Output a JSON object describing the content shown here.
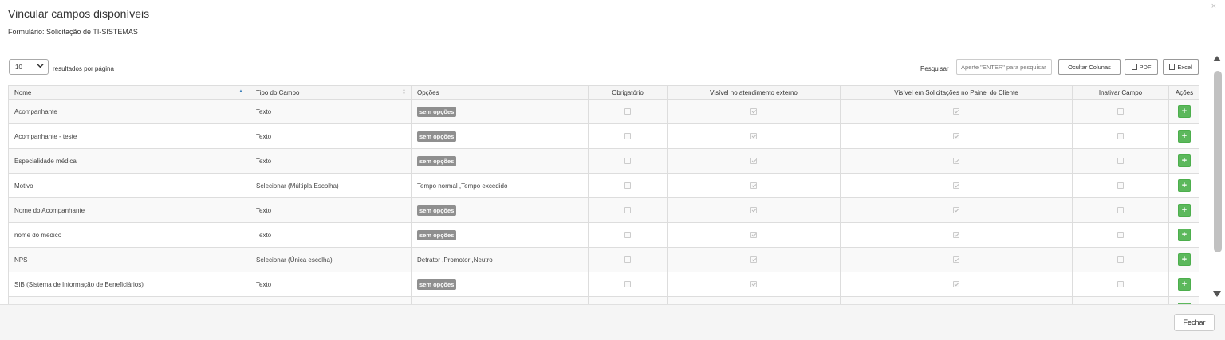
{
  "modal": {
    "title": "Vincular campos disponíveis",
    "subtitle": "Formulário: Solicitação de TI-SISTEMAS",
    "close_glyph": "×"
  },
  "controls": {
    "page_length": "10",
    "page_length_label": "resultados por página",
    "search_label": "Pesquisar",
    "search_placeholder": "Aperte \"ENTER\" para pesquisar",
    "hide_columns_label": "Ocultar Colunas",
    "pdf_label": "PDF",
    "excel_label": "Excel"
  },
  "table": {
    "columns": [
      "Nome",
      "Tipo do Campo",
      "Opções",
      "Obrigatório",
      "Visível no atendimento externo",
      "Visível em Solicitações no Painel do Cliente",
      "Inativar Campo",
      "Ações"
    ],
    "no_options_label": "sem opções",
    "add_label": "+",
    "rows": [
      {
        "nome": "Acompanhante",
        "tipo": "Texto",
        "opcoes": "",
        "obrigatorio": false,
        "visivel_externo": true,
        "visivel_painel": true,
        "inativar": false
      },
      {
        "nome": "Acompanhante - teste",
        "tipo": "Texto",
        "opcoes": "",
        "obrigatorio": false,
        "visivel_externo": true,
        "visivel_painel": true,
        "inativar": false
      },
      {
        "nome": "Especialidade médica",
        "tipo": "Texto",
        "opcoes": "",
        "obrigatorio": false,
        "visivel_externo": true,
        "visivel_painel": true,
        "inativar": false
      },
      {
        "nome": "Motivo",
        "tipo": "Selecionar (Múltipla Escolha)",
        "opcoes": "Tempo normal ,Tempo excedido",
        "obrigatorio": false,
        "visivel_externo": true,
        "visivel_painel": true,
        "inativar": false
      },
      {
        "nome": "Nome do Acompanhante",
        "tipo": "Texto",
        "opcoes": "",
        "obrigatorio": false,
        "visivel_externo": true,
        "visivel_painel": true,
        "inativar": false
      },
      {
        "nome": "nome do médico",
        "tipo": "Texto",
        "opcoes": "",
        "obrigatorio": false,
        "visivel_externo": true,
        "visivel_painel": true,
        "inativar": false
      },
      {
        "nome": "NPS",
        "tipo": "Selecionar (Única escolha)",
        "opcoes": "Detrator ,Promotor ,Neutro",
        "obrigatorio": false,
        "visivel_externo": true,
        "visivel_painel": true,
        "inativar": false
      },
      {
        "nome": "SIB (Sistema de Informação de Beneficiários)",
        "tipo": "Texto",
        "opcoes": "",
        "obrigatorio": false,
        "visivel_externo": true,
        "visivel_painel": true,
        "inativar": false
      },
      {
        "nome": "",
        "tipo": "",
        "opcoes": "",
        "obrigatorio": false,
        "visivel_externo": true,
        "visivel_painel": true,
        "inativar": false
      }
    ]
  },
  "footer": {
    "close_label": "Fechar"
  }
}
